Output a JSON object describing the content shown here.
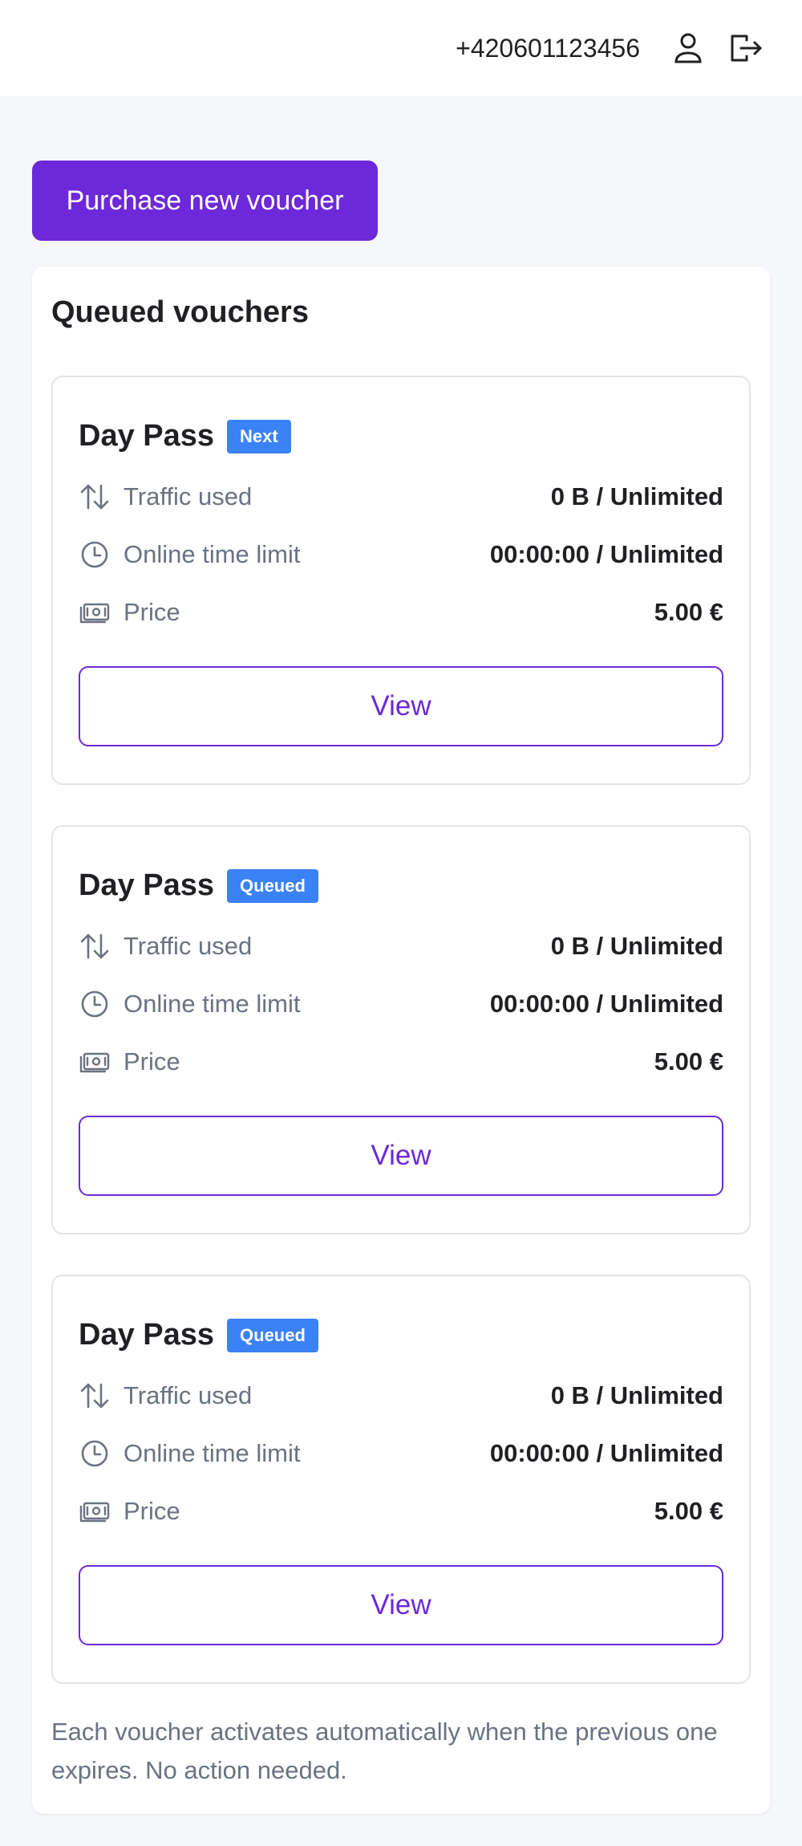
{
  "header": {
    "phone": "+420601123456",
    "user_icon": "user-icon",
    "logout_icon": "logout-icon"
  },
  "purchase_button_label": "Purchase new voucher",
  "panel": {
    "title": "Queued vouchers",
    "footnote": "Each voucher activates automatically when the previous one expires. No action needed."
  },
  "vouchers": [
    {
      "title": "Day Pass",
      "badge": "Next",
      "traffic_label": "Traffic used",
      "traffic_value": "0 B / Unlimited",
      "time_label": "Online time limit",
      "time_value": "00:00:00 / Unlimited",
      "price_label": "Price",
      "price_value": "5.00 €",
      "view_label": "View"
    },
    {
      "title": "Day Pass",
      "badge": "Queued",
      "traffic_label": "Traffic used",
      "traffic_value": "0 B / Unlimited",
      "time_label": "Online time limit",
      "time_value": "00:00:00 / Unlimited",
      "price_label": "Price",
      "price_value": "5.00 €",
      "view_label": "View"
    },
    {
      "title": "Day Pass",
      "badge": "Queued",
      "traffic_label": "Traffic used",
      "traffic_value": "0 B / Unlimited",
      "time_label": "Online time limit",
      "time_value": "00:00:00 / Unlimited",
      "price_label": "Price",
      "price_value": "5.00 €",
      "view_label": "View"
    }
  ],
  "colors": {
    "accent": "#6d28d9",
    "badge": "#3b82f6",
    "page_background": "#f6f7fb",
    "muted_text": "#6b7280"
  }
}
